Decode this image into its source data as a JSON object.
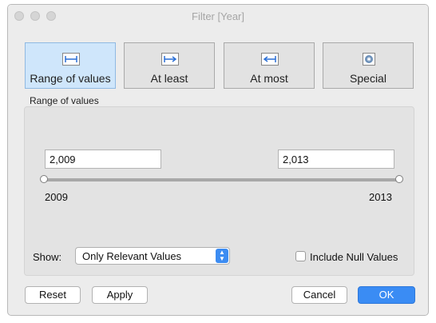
{
  "window": {
    "title": "Filter [Year]"
  },
  "modes": [
    {
      "label": "Range of values",
      "icon": "range-icon",
      "selected": true
    },
    {
      "label": "At least",
      "icon": "at-least-icon",
      "selected": false
    },
    {
      "label": "At most",
      "icon": "at-most-icon",
      "selected": false
    },
    {
      "label": "Special",
      "icon": "special-icon",
      "selected": false
    }
  ],
  "range": {
    "section_label": "Range of values",
    "min_value": "2,009",
    "max_value": "2,013",
    "min_tick": "2009",
    "max_tick": "2013"
  },
  "show": {
    "label": "Show:",
    "selected": "Only Relevant Values",
    "arrow_up": "▲",
    "arrow_down": "▼"
  },
  "include_null": {
    "label": "Include Null Values",
    "checked": false
  },
  "buttons": {
    "reset": "Reset",
    "apply": "Apply",
    "cancel": "Cancel",
    "ok": "OK"
  },
  "colors": {
    "accent": "#3a8cf4",
    "selected_mode": "#cfe6fb"
  }
}
